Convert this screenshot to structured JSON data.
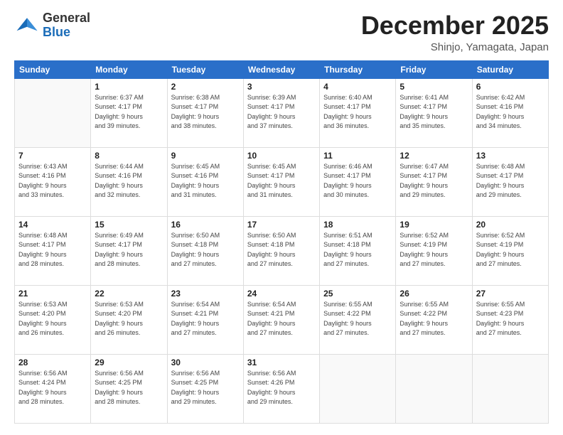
{
  "header": {
    "logo_general": "General",
    "logo_blue": "Blue",
    "month_title": "December 2025",
    "subtitle": "Shinjo, Yamagata, Japan"
  },
  "days_of_week": [
    "Sunday",
    "Monday",
    "Tuesday",
    "Wednesday",
    "Thursday",
    "Friday",
    "Saturday"
  ],
  "weeks": [
    [
      {
        "day": "",
        "info": ""
      },
      {
        "day": "1",
        "info": "Sunrise: 6:37 AM\nSunset: 4:17 PM\nDaylight: 9 hours\nand 39 minutes."
      },
      {
        "day": "2",
        "info": "Sunrise: 6:38 AM\nSunset: 4:17 PM\nDaylight: 9 hours\nand 38 minutes."
      },
      {
        "day": "3",
        "info": "Sunrise: 6:39 AM\nSunset: 4:17 PM\nDaylight: 9 hours\nand 37 minutes."
      },
      {
        "day": "4",
        "info": "Sunrise: 6:40 AM\nSunset: 4:17 PM\nDaylight: 9 hours\nand 36 minutes."
      },
      {
        "day": "5",
        "info": "Sunrise: 6:41 AM\nSunset: 4:17 PM\nDaylight: 9 hours\nand 35 minutes."
      },
      {
        "day": "6",
        "info": "Sunrise: 6:42 AM\nSunset: 4:16 PM\nDaylight: 9 hours\nand 34 minutes."
      }
    ],
    [
      {
        "day": "7",
        "info": "Sunrise: 6:43 AM\nSunset: 4:16 PM\nDaylight: 9 hours\nand 33 minutes."
      },
      {
        "day": "8",
        "info": "Sunrise: 6:44 AM\nSunset: 4:16 PM\nDaylight: 9 hours\nand 32 minutes."
      },
      {
        "day": "9",
        "info": "Sunrise: 6:45 AM\nSunset: 4:16 PM\nDaylight: 9 hours\nand 31 minutes."
      },
      {
        "day": "10",
        "info": "Sunrise: 6:45 AM\nSunset: 4:17 PM\nDaylight: 9 hours\nand 31 minutes."
      },
      {
        "day": "11",
        "info": "Sunrise: 6:46 AM\nSunset: 4:17 PM\nDaylight: 9 hours\nand 30 minutes."
      },
      {
        "day": "12",
        "info": "Sunrise: 6:47 AM\nSunset: 4:17 PM\nDaylight: 9 hours\nand 29 minutes."
      },
      {
        "day": "13",
        "info": "Sunrise: 6:48 AM\nSunset: 4:17 PM\nDaylight: 9 hours\nand 29 minutes."
      }
    ],
    [
      {
        "day": "14",
        "info": "Sunrise: 6:48 AM\nSunset: 4:17 PM\nDaylight: 9 hours\nand 28 minutes."
      },
      {
        "day": "15",
        "info": "Sunrise: 6:49 AM\nSunset: 4:17 PM\nDaylight: 9 hours\nand 28 minutes."
      },
      {
        "day": "16",
        "info": "Sunrise: 6:50 AM\nSunset: 4:18 PM\nDaylight: 9 hours\nand 27 minutes."
      },
      {
        "day": "17",
        "info": "Sunrise: 6:50 AM\nSunset: 4:18 PM\nDaylight: 9 hours\nand 27 minutes."
      },
      {
        "day": "18",
        "info": "Sunrise: 6:51 AM\nSunset: 4:18 PM\nDaylight: 9 hours\nand 27 minutes."
      },
      {
        "day": "19",
        "info": "Sunrise: 6:52 AM\nSunset: 4:19 PM\nDaylight: 9 hours\nand 27 minutes."
      },
      {
        "day": "20",
        "info": "Sunrise: 6:52 AM\nSunset: 4:19 PM\nDaylight: 9 hours\nand 27 minutes."
      }
    ],
    [
      {
        "day": "21",
        "info": "Sunrise: 6:53 AM\nSunset: 4:20 PM\nDaylight: 9 hours\nand 26 minutes."
      },
      {
        "day": "22",
        "info": "Sunrise: 6:53 AM\nSunset: 4:20 PM\nDaylight: 9 hours\nand 26 minutes."
      },
      {
        "day": "23",
        "info": "Sunrise: 6:54 AM\nSunset: 4:21 PM\nDaylight: 9 hours\nand 27 minutes."
      },
      {
        "day": "24",
        "info": "Sunrise: 6:54 AM\nSunset: 4:21 PM\nDaylight: 9 hours\nand 27 minutes."
      },
      {
        "day": "25",
        "info": "Sunrise: 6:55 AM\nSunset: 4:22 PM\nDaylight: 9 hours\nand 27 minutes."
      },
      {
        "day": "26",
        "info": "Sunrise: 6:55 AM\nSunset: 4:22 PM\nDaylight: 9 hours\nand 27 minutes."
      },
      {
        "day": "27",
        "info": "Sunrise: 6:55 AM\nSunset: 4:23 PM\nDaylight: 9 hours\nand 27 minutes."
      }
    ],
    [
      {
        "day": "28",
        "info": "Sunrise: 6:56 AM\nSunset: 4:24 PM\nDaylight: 9 hours\nand 28 minutes."
      },
      {
        "day": "29",
        "info": "Sunrise: 6:56 AM\nSunset: 4:25 PM\nDaylight: 9 hours\nand 28 minutes."
      },
      {
        "day": "30",
        "info": "Sunrise: 6:56 AM\nSunset: 4:25 PM\nDaylight: 9 hours\nand 29 minutes."
      },
      {
        "day": "31",
        "info": "Sunrise: 6:56 AM\nSunset: 4:26 PM\nDaylight: 9 hours\nand 29 minutes."
      },
      {
        "day": "",
        "info": ""
      },
      {
        "day": "",
        "info": ""
      },
      {
        "day": "",
        "info": ""
      }
    ]
  ]
}
